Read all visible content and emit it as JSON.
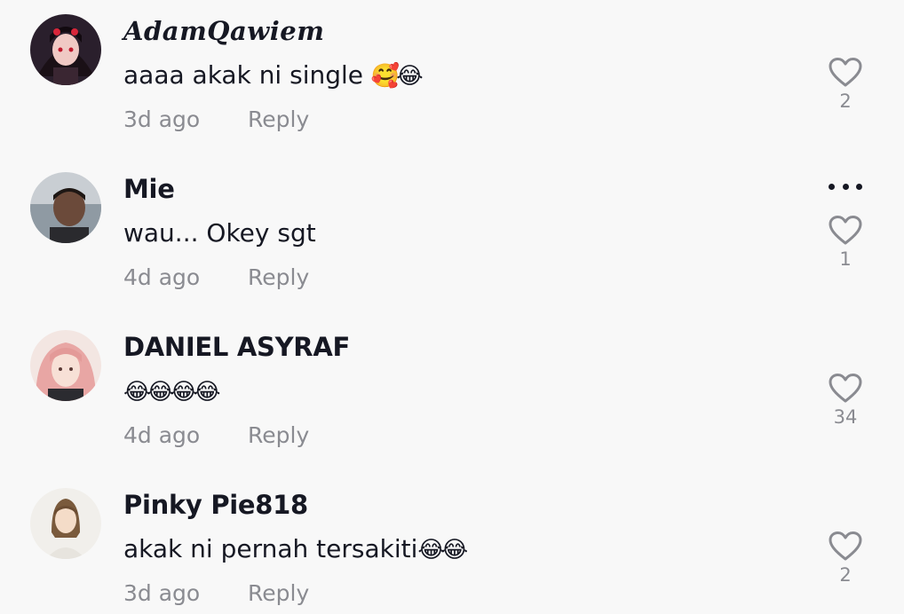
{
  "comments": [
    {
      "username": "AdamQawiem",
      "text": "aaaa akak ni single",
      "emoji": "🥰😂",
      "time": "3d ago",
      "reply_label": "Reply",
      "likes": "2"
    },
    {
      "username": "Mie",
      "text": "wau... Okey sgt",
      "emoji": "",
      "time": "4d ago",
      "reply_label": "Reply",
      "likes": "1"
    },
    {
      "username": "DANIEL ASYRAF",
      "text": "",
      "emoji": "😂😂😂😂",
      "time": "4d ago",
      "reply_label": "Reply",
      "likes": "34"
    },
    {
      "username": "Pinky Pie818",
      "text": "akak ni pernah tersakiti",
      "emoji": "😂😂",
      "time": "3d ago",
      "reply_label": "Reply",
      "likes": "2"
    }
  ],
  "icons": {
    "like": "heart-outline-icon",
    "more": "more-options-icon"
  },
  "colors": {
    "background": "#f8f8f8",
    "primary_text": "#161823",
    "secondary_text": "#8a8b91"
  }
}
